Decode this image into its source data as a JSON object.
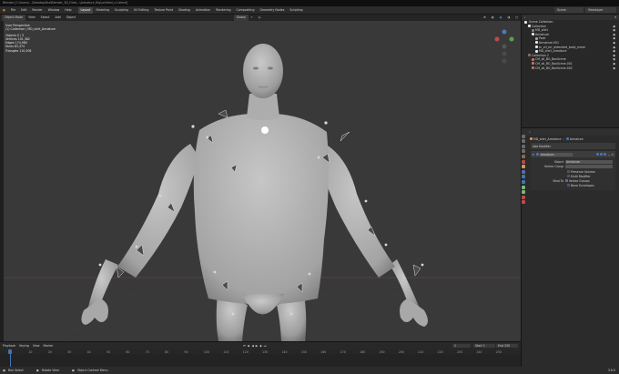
{
  "window_title": "Blender [C:\\Users\\...\\Desktop\\fbx\\Blender_3D_Files\\...\\Armature_Rig\\untitled_v1.blend]",
  "menus": [
    "File",
    "Edit",
    "Render",
    "Window",
    "Help"
  ],
  "workspace_tabs": [
    "Layout",
    "Modeling",
    "Sculpting",
    "UV Editing",
    "Texture Paint",
    "Shading",
    "Animation",
    "Rendering",
    "Compositing",
    "Geometry Nodes",
    "Scripting"
  ],
  "active_tab": "Layout",
  "scene": {
    "scene_label": "Scene",
    "view_layer_label": "ViewLayer"
  },
  "viewport_header": {
    "mode": "Object Mode",
    "menus": [
      "View",
      "Select",
      "Add",
      "Object"
    ],
    "transform": "Global",
    "options_label": "Options"
  },
  "viewport_stats": {
    "view": "User Perspective",
    "collection": "(1) Collection | MD_shirt_Armature",
    "lines": [
      "Objects  0 / 3",
      "Vertices  101,382",
      "Edges  174,980",
      "Faces  83,374",
      "Triangles  110,508"
    ]
  },
  "outliner": {
    "header": "Scene Collection",
    "items": [
      {
        "label": "Collection",
        "color": "#e5e5e5",
        "indent": 1
      },
      {
        "label": "MD_shirt",
        "color": "#6e8a6e",
        "indent": 2
      },
      {
        "label": "Armature",
        "color": "#e5e5e5",
        "indent": 2
      },
      {
        "label": "Pose",
        "color": "#7ab87a",
        "indent": 3
      },
      {
        "label": "Armature.001",
        "color": "#e5e5e5",
        "indent": 3
      },
      {
        "label": "m_ctl_mr_extended_body_mesh",
        "color": "#e5e5e5",
        "indent": 3
      },
      {
        "label": "MD_shirt_Armature",
        "color": "#e5e5e5",
        "indent": 3
      },
      {
        "label": "Collection 2",
        "color": "#8a6b6b",
        "indent": 1
      },
      {
        "label": "CM_all_BG_BoxScene",
        "color": "#b07a6a",
        "indent": 2
      },
      {
        "label": "CM_all_BG_BoxScene.001",
        "color": "#b07a6a",
        "indent": 2
      },
      {
        "label": "CM_all_BG_BoxScene.002",
        "color": "#b07a6a",
        "indent": 2
      }
    ]
  },
  "properties": {
    "breadcrumb_object": "MD_shirt_Armature",
    "breadcrumb_modifier": "Armature",
    "add_modifier": "Add Modifier",
    "modifier_name": "Armature",
    "object_label": "Object",
    "object_value": "Armature",
    "vertex_group_label": "Vertex Group",
    "checkboxes": [
      {
        "label": "Preserve Volume",
        "checked": false
      },
      {
        "label": "Multi Modifier",
        "checked": false
      }
    ],
    "bind_to_label": "Bind To",
    "bind_options": [
      {
        "label": "Vertex Groups",
        "checked": true
      },
      {
        "label": "Bone Envelopes",
        "checked": false
      }
    ]
  },
  "timeline": {
    "menus": [
      "Playback",
      "Keying",
      "View",
      "Marker"
    ],
    "start_label": "Start",
    "start": "1",
    "end_label": "End",
    "end": "250",
    "current_frame": "1",
    "ticks": [
      "0",
      "10",
      "20",
      "30",
      "40",
      "50",
      "60",
      "70",
      "80",
      "90",
      "100",
      "110",
      "120",
      "130",
      "140",
      "150",
      "160",
      "170",
      "180",
      "190",
      "200",
      "210",
      "220",
      "230",
      "240",
      "250"
    ]
  },
  "statusbar": {
    "select": "Box Select",
    "rotate": "Rotate View",
    "menu": "Object Context Menu",
    "version": "3.6.0"
  },
  "colors": {
    "accent": "#4772b3",
    "active_tab": "#474747",
    "viewport_bg": "#393939"
  }
}
